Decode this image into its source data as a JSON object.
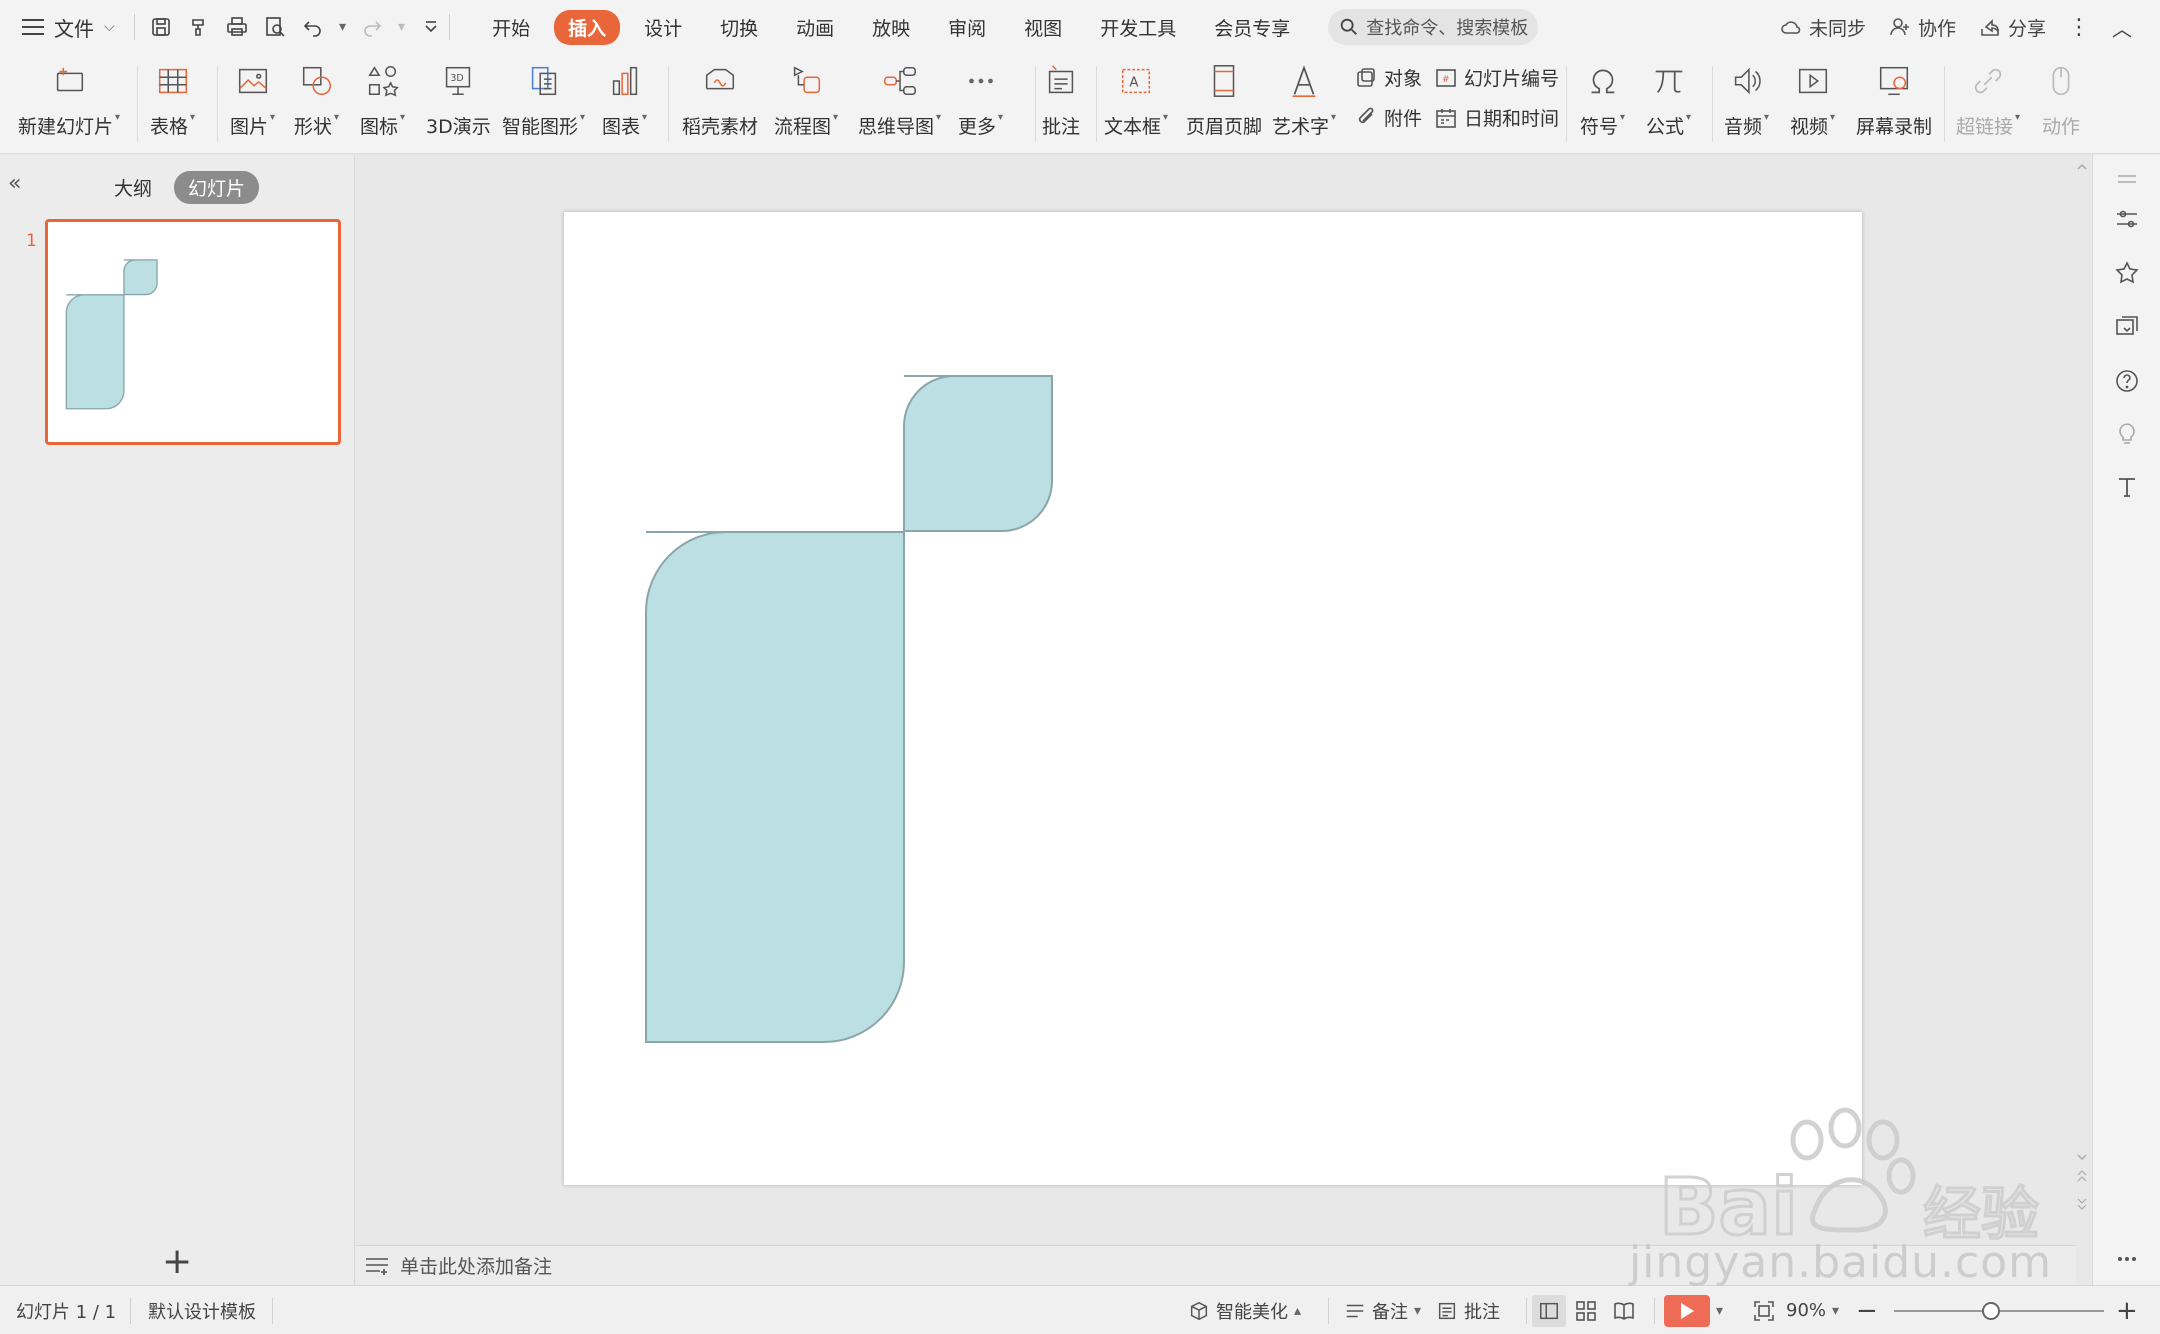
{
  "menubar": {
    "file_label": "文件",
    "tabs": [
      "开始",
      "插入",
      "设计",
      "切换",
      "动画",
      "放映",
      "审阅",
      "视图",
      "开发工具",
      "会员专享"
    ],
    "active_tab": "插入",
    "search_placeholder": "查找命令、搜索模板",
    "sync_label": "未同步",
    "collab_label": "协作",
    "share_label": "分享"
  },
  "ribbon": {
    "new_slide": "新建幻灯片",
    "table": "表格",
    "picture": "图片",
    "shape": "形状",
    "icon": "图标",
    "demo3d": "3D演示",
    "smart_graphic": "智能图形",
    "chart": "图表",
    "docer_material": "稻壳素材",
    "flowchart": "流程图",
    "mindmap": "思维导图",
    "more": "更多",
    "comment": "批注",
    "textbox": "文本框",
    "header_footer": "页眉页脚",
    "wordart": "艺术字",
    "object": "对象",
    "slide_number": "幻灯片编号",
    "attachment": "附件",
    "date_time": "日期和时间",
    "symbol": "符号",
    "formula": "公式",
    "audio": "音频",
    "video": "视频",
    "screen_record": "屏幕录制",
    "hyperlink": "超链接",
    "action": "动作"
  },
  "leftpane": {
    "outline_tab": "大纲",
    "slides_tab": "幻灯片",
    "slide_number": "1"
  },
  "notes": {
    "placeholder": "单击此处添加备注"
  },
  "statusbar": {
    "slide_info": "幻灯片 1 / 1",
    "template": "默认设计模板",
    "smart_beautify": "智能美化",
    "notes": "备注",
    "comments": "批注",
    "zoom": "90%"
  },
  "slide": {
    "shape_fill": "#bbdfe2",
    "shape_stroke": "#8aa6aa"
  },
  "watermark": {
    "brand": "Bai du 经验",
    "url": "jingyan.baidu.com"
  },
  "colors": {
    "accent": "#e8663a",
    "play": "#ee6c56"
  }
}
